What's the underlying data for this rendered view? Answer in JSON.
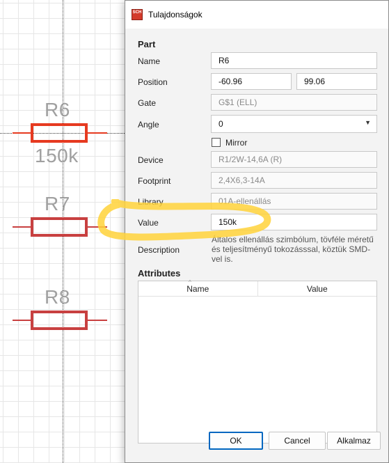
{
  "dialog": {
    "title": "Tulajdonságok",
    "app_icon_text": "SCH",
    "part": {
      "heading": "Part",
      "name_label": "Name",
      "name_value": "R6",
      "position_label": "Position",
      "position_x": "-60.96",
      "position_y": "99.06",
      "gate_label": "Gate",
      "gate_value": "G$1 (ELL)",
      "angle_label": "Angle",
      "angle_value": "0",
      "mirror_label": "Mirror",
      "device_label": "Device",
      "device_value": "R1/2W-14,6A (R)",
      "footprint_label": "Footprint",
      "footprint_value": "2,4X6,3-14A",
      "library_label": "Library",
      "library_value": "01A-ellenállás",
      "value_label": "Value",
      "value_value": "150k",
      "description_label": "Description",
      "description_text": "Általos ellenállás szimbólum, tövféle méretű és teljesítményű tokozásssal, köztük SMD-vel is."
    },
    "attributes": {
      "heading": "Attributes",
      "columns": [
        "Name",
        "Value"
      ]
    },
    "buttons": {
      "ok": "OK",
      "cancel": "Cancel",
      "apply": "Alkalmaz"
    }
  },
  "schematic": {
    "resistors": [
      {
        "name": "R6",
        "value": "150k",
        "selected": true
      },
      {
        "name": "R7",
        "value": "",
        "selected": false
      },
      {
        "name": "R8",
        "value": "",
        "selected": false
      }
    ]
  },
  "colors": {
    "selected_part": "#e63a20",
    "part": "#c84040",
    "label_text": "#a0a0a0",
    "highlight": "#ffd23a",
    "default_button_border": "#0067c0"
  }
}
